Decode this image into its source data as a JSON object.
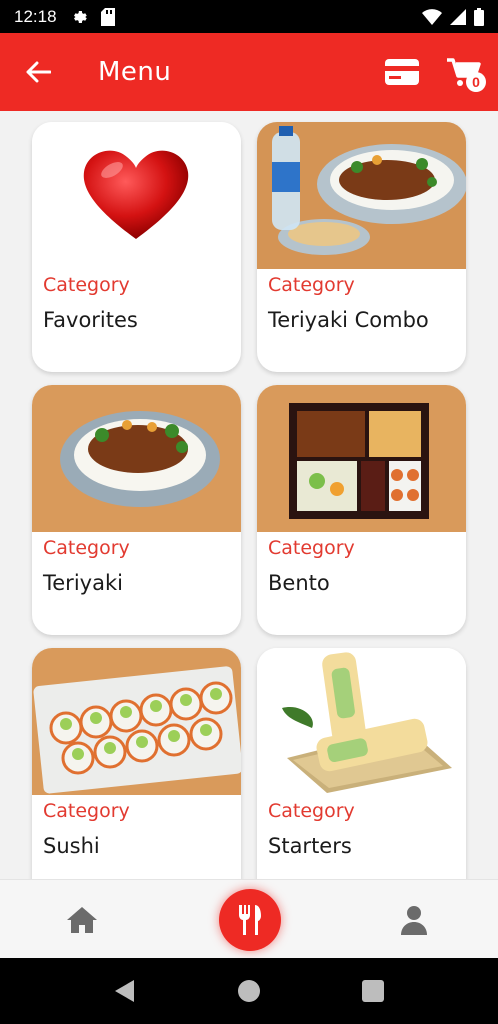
{
  "status_bar": {
    "time": "12:18"
  },
  "app_bar": {
    "title": "Menu",
    "cart_count": "0"
  },
  "categories": [
    {
      "label": "Category",
      "name": "Favorites"
    },
    {
      "label": "Category",
      "name": "Teriyaki Combo"
    },
    {
      "label": "Category",
      "name": "Teriyaki"
    },
    {
      "label": "Category",
      "name": "Bento"
    },
    {
      "label": "Category",
      "name": "Sushi"
    },
    {
      "label": "Category",
      "name": "Starters"
    }
  ],
  "colors": {
    "accent": "#ee2a24",
    "category_label": "#e23a30",
    "background": "#f2f2f2"
  },
  "icons": {
    "back": "arrow-left-icon",
    "payment": "credit-card-icon",
    "cart": "shopping-cart-icon",
    "home": "home-icon",
    "menu": "utensils-icon",
    "profile": "user-icon"
  }
}
